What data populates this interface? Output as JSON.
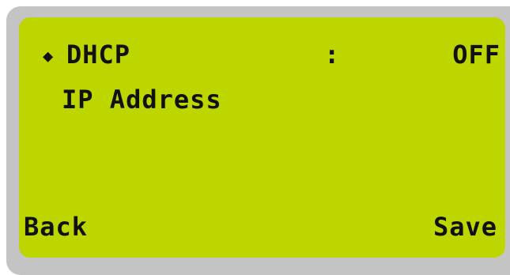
{
  "menu": {
    "selected_marker": "◆",
    "items": [
      {
        "label": "DHCP",
        "separator": ":",
        "value": "OFF"
      },
      {
        "label": "IP Address"
      }
    ]
  },
  "softkeys": {
    "left_label": "Back",
    "right_label": "Save"
  },
  "colors": {
    "lcd_background": "#bdd600",
    "bezel": "#c4c4c4",
    "text": "#111111"
  }
}
